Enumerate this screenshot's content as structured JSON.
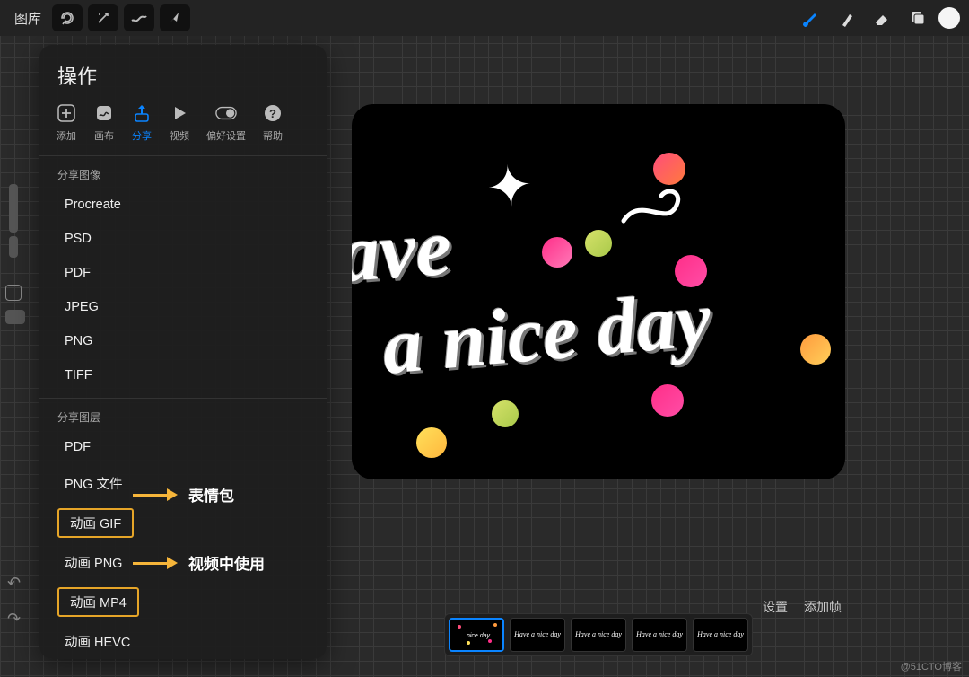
{
  "topbar": {
    "library": "图库",
    "tools": [
      "wrench",
      "wand",
      "s-curve",
      "arrow"
    ],
    "right": [
      "brush",
      "smudge",
      "eraser",
      "layers",
      "avatar"
    ]
  },
  "panel": {
    "title": "操作",
    "tabs": [
      {
        "icon": "plus",
        "label": "添加"
      },
      {
        "icon": "canvas",
        "label": "画布"
      },
      {
        "icon": "share",
        "label": "分享",
        "active": true
      },
      {
        "icon": "video",
        "label": "视频"
      },
      {
        "icon": "prefs",
        "label": "偏好设置"
      },
      {
        "icon": "help",
        "label": "帮助"
      }
    ],
    "section_image": "分享图像",
    "image_formats": [
      "Procreate",
      "PSD",
      "PDF",
      "JPEG",
      "PNG",
      "TIFF"
    ],
    "section_layer": "分享图层",
    "layer_formats": [
      {
        "label": "PDF"
      },
      {
        "label": "PNG 文件"
      },
      {
        "label": "动画 GIF",
        "highlight": true,
        "note": "表情包"
      },
      {
        "label": "动画 PNG"
      },
      {
        "label": "动画 MP4",
        "highlight": true,
        "note": "视频中使用"
      },
      {
        "label": "动画 HEVC"
      }
    ]
  },
  "canvas": {
    "line1": "ave",
    "line2": "a nice day",
    "thumb_text": "Have a nice day"
  },
  "timeline": {
    "settings": "设置",
    "add_frame": "添加帧",
    "frames": 5
  },
  "watermark": "@51CTO博客"
}
